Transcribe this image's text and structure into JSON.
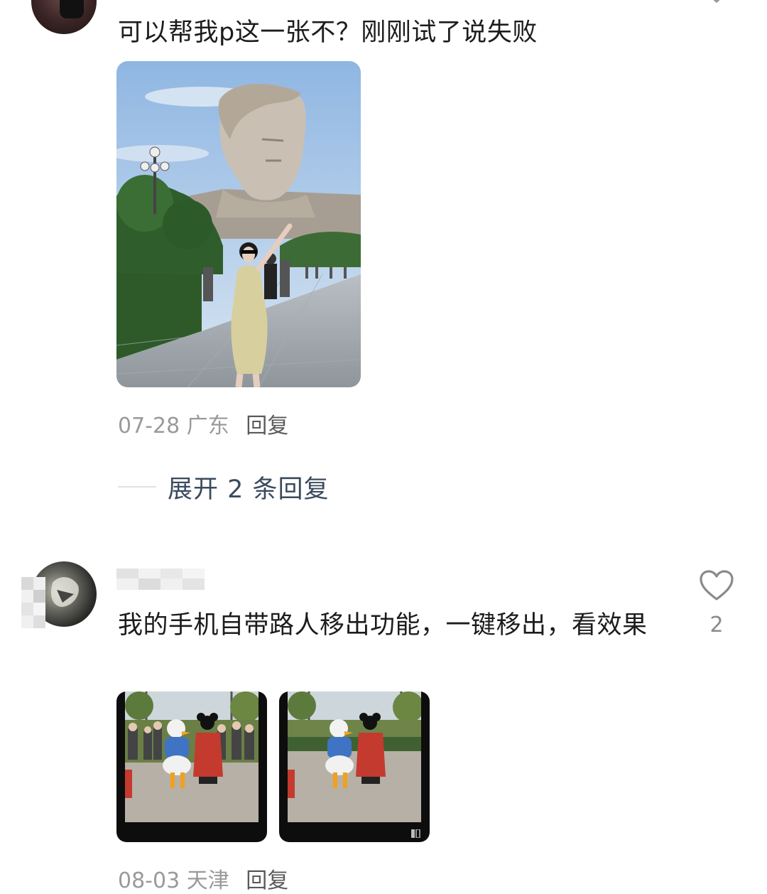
{
  "comment1": {
    "text": "可以帮我p这一张不？刚刚试了说失败",
    "meta": {
      "date": "07-28",
      "location": "广东",
      "reply_label": "回复"
    },
    "expand_label": "展开 2 条回复"
  },
  "comment2": {
    "text": "我的手机自带路人移出功能，一键移出，看效果",
    "like_count": "2",
    "meta": {
      "date": "08-03",
      "location": "天津",
      "reply_label": "回复"
    }
  },
  "colors": {
    "background": "#ffffff",
    "text": "#1c1c1c",
    "meta": "#9a9a9a",
    "expand": "#3b4a5e"
  },
  "icons": [
    "heart-icon",
    "chevron-down-icon"
  ]
}
